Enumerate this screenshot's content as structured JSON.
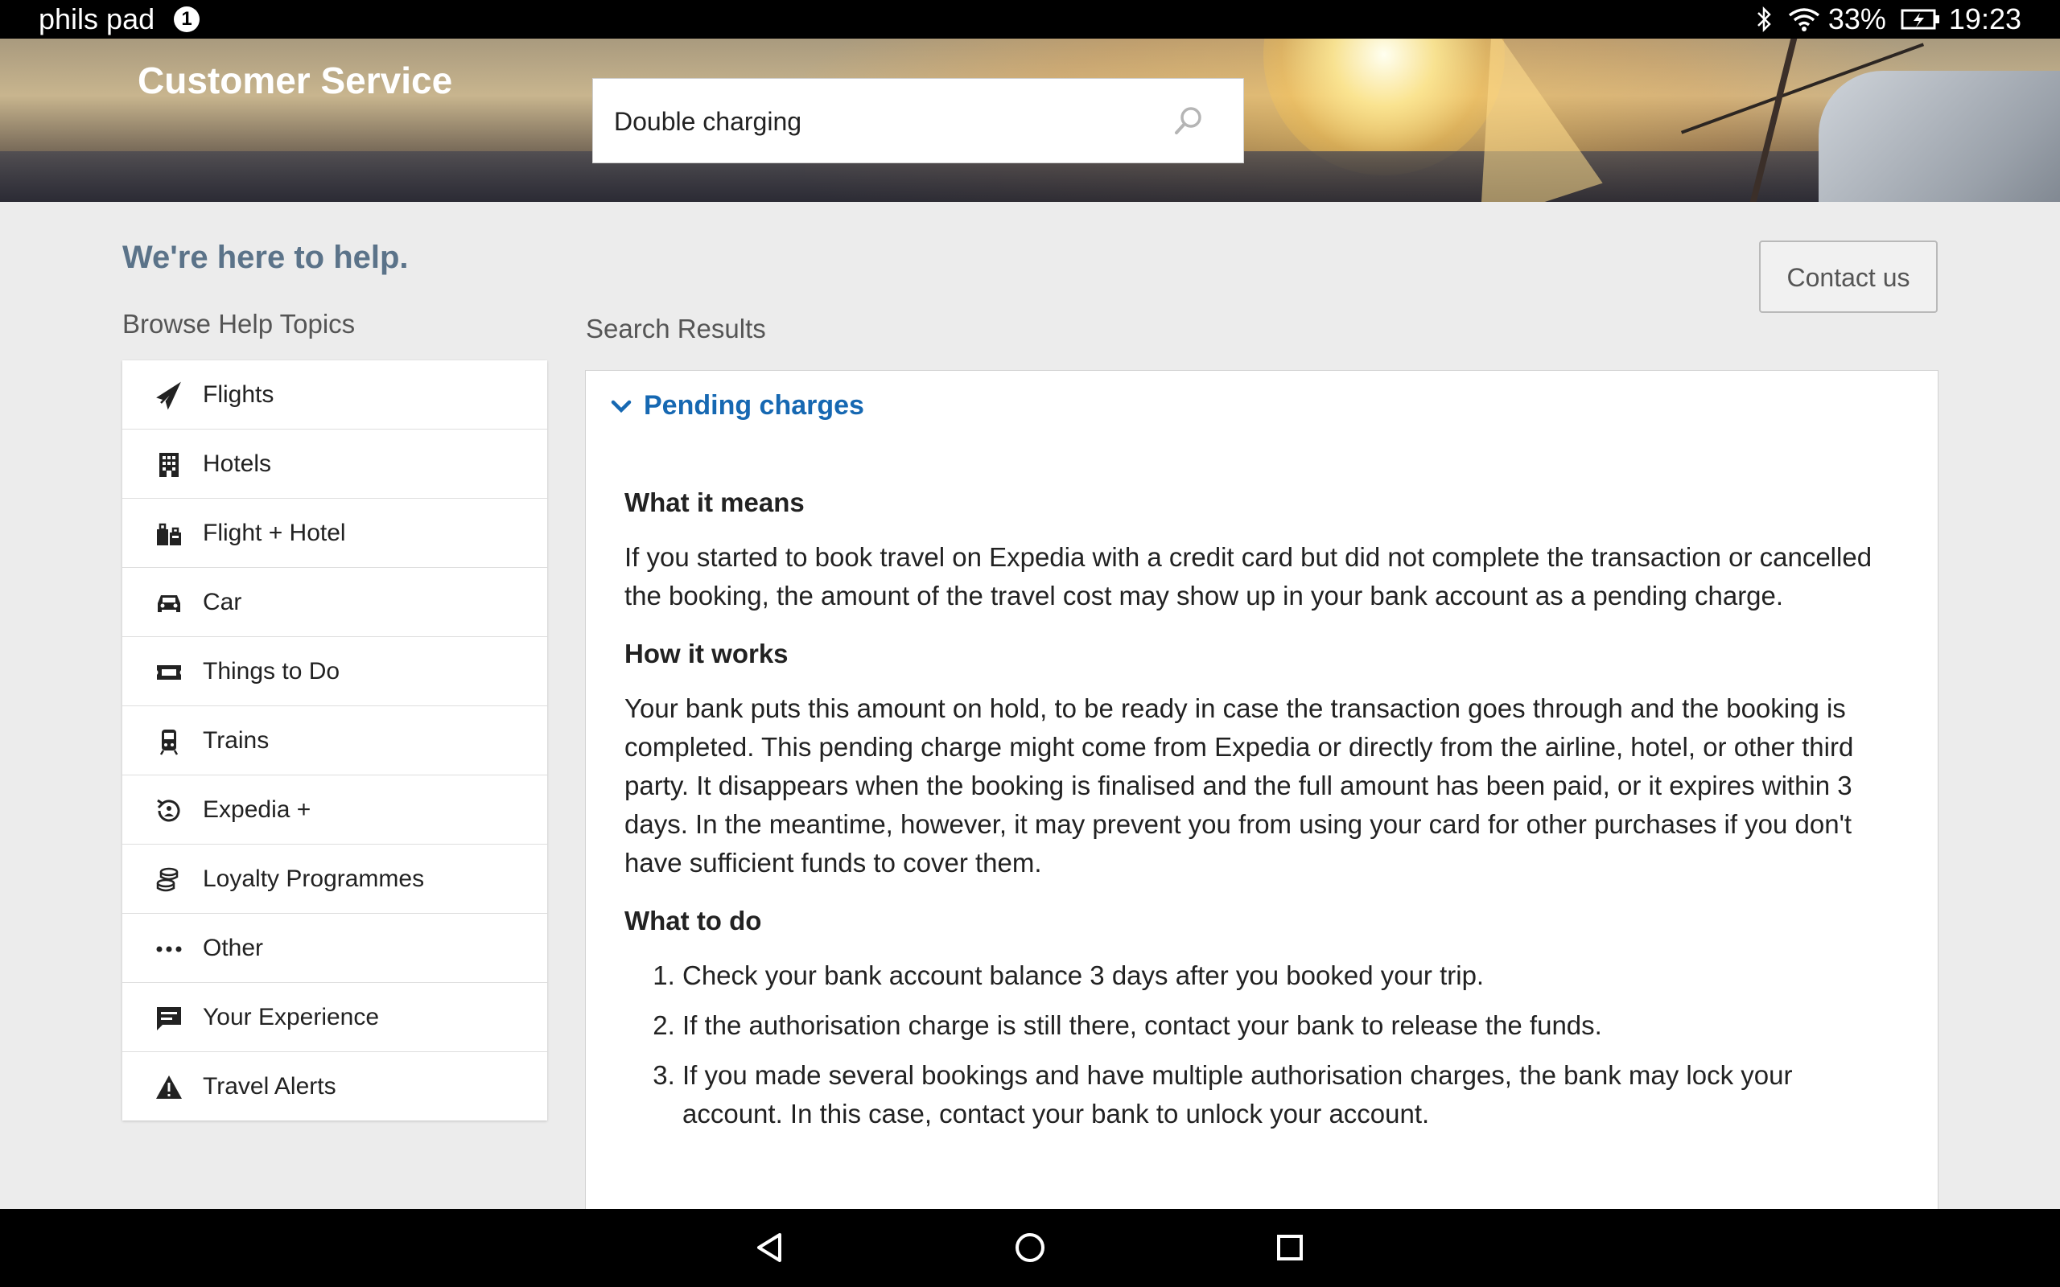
{
  "status_bar": {
    "device_name": "phils pad",
    "notification_count": "1",
    "battery_percent": "33%",
    "time": "19:23",
    "icons": [
      "bluetooth-icon",
      "wifi-icon",
      "battery-charging-icon"
    ]
  },
  "header": {
    "title": "Customer Service",
    "search": {
      "value": "Double charging",
      "icon": "search-icon"
    }
  },
  "help": {
    "title": "We're here to help.",
    "contact_label": "Contact us",
    "browse_label": "Browse Help Topics",
    "results_label": "Search Results"
  },
  "topics": [
    {
      "label": "Flights",
      "icon": "plane-icon"
    },
    {
      "label": "Hotels",
      "icon": "building-icon"
    },
    {
      "label": "Flight + Hotel",
      "icon": "luggage-icon"
    },
    {
      "label": "Car",
      "icon": "car-icon"
    },
    {
      "label": "Things to Do",
      "icon": "ticket-icon"
    },
    {
      "label": "Trains",
      "icon": "train-icon"
    },
    {
      "label": "Expedia +",
      "icon": "expedia-plus-icon"
    },
    {
      "label": "Loyalty Programmes",
      "icon": "coins-icon"
    },
    {
      "label": "Other",
      "icon": "more-dots-icon"
    },
    {
      "label": "Your Experience",
      "icon": "feedback-icon"
    },
    {
      "label": "Travel Alerts",
      "icon": "warning-icon"
    }
  ],
  "result": {
    "title": "Pending charges",
    "sections": {
      "what_heading": "What it means",
      "what_text": "If you started to book travel on Expedia with a credit card but did not complete the transaction or cancelled the booking, the amount of the travel cost may show up in your bank account as a pending charge.",
      "how_heading": "How it works",
      "how_text": "Your bank puts this amount on hold, to be ready in case the transaction goes through and the booking is completed. This pending charge might come from Expedia or directly from the airline, hotel, or other third party. It disappears when the booking is finalised and the full amount has been paid, or it expires within 3 days. In the meantime, however, it may prevent you from using your card for other purchases if you don't have sufficient funds to cover them.",
      "todo_heading": "What to do",
      "steps": [
        "Check your bank account balance 3 days after you booked your trip.",
        "If the authorisation charge is still there, contact your bank to release the funds.",
        "If you made several bookings and have multiple authorisation charges, the bank may lock your account. In this case, contact your bank to unlock your account."
      ]
    }
  },
  "nav_bar": {
    "buttons": [
      "back-icon",
      "home-icon",
      "recents-icon"
    ]
  }
}
